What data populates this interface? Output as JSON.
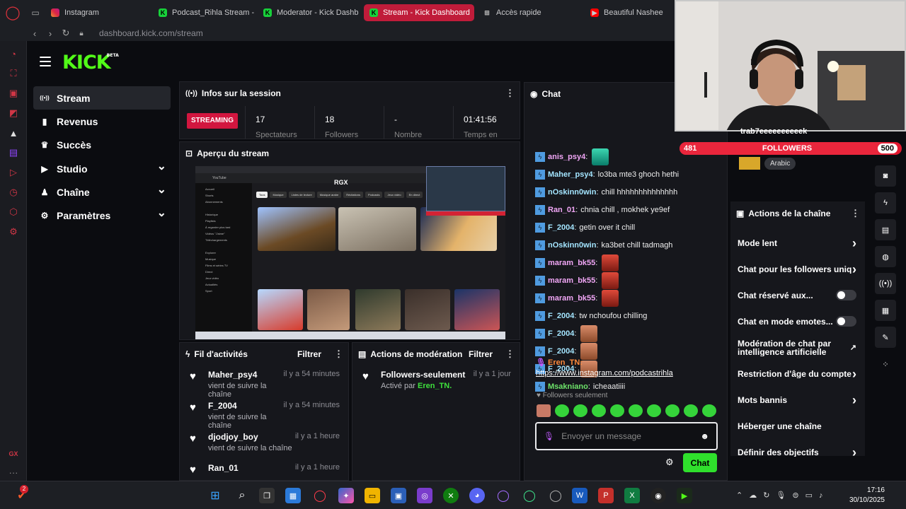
{
  "browser": {
    "tabs": [
      {
        "label": "Instagram",
        "fav": "insta"
      },
      {
        "label": "Podcast_Rihla Stream -",
        "fav": "kick"
      },
      {
        "label": "Moderator - Kick Dashb",
        "fav": "kick"
      },
      {
        "label": "Stream - Kick Dashboard",
        "fav": "kick",
        "active": true
      },
      {
        "label": "Accès rapide",
        "fav": "grid"
      },
      {
        "label": "Beautiful Nashee",
        "fav": "yt"
      }
    ],
    "url_host": "dashboard.kick.com",
    "url_path": "/stream"
  },
  "logo": {
    "text": "KICK",
    "beta": "BETA"
  },
  "left_nav": [
    {
      "label": "Stream",
      "icon": "broadcast-icon",
      "active": true
    },
    {
      "label": "Revenus",
      "icon": "chart-icon"
    },
    {
      "label": "Succès",
      "icon": "trophy-icon"
    },
    {
      "label": "Studio",
      "icon": "studio-icon",
      "expandable": true
    },
    {
      "label": "Chaîne",
      "icon": "person-icon",
      "expandable": true
    },
    {
      "label": "Paramètres",
      "icon": "gear-icon",
      "expandable": true
    }
  ],
  "session": {
    "title": "Infos sur la session",
    "status": "STREAMING",
    "stats": [
      {
        "value": "17",
        "label": "Spectateurs"
      },
      {
        "value": "18",
        "label": "Followers"
      },
      {
        "value": "-",
        "label": "Nombre"
      },
      {
        "value": "01:41:56",
        "label": "Temps en"
      }
    ]
  },
  "preview": {
    "title": "Aperçu du stream",
    "overlay_text": "RGX"
  },
  "activity": {
    "title": "Fil d'activités",
    "filter": "Filtrer",
    "items": [
      {
        "name": "Maher_psy4",
        "action": "vient de suivre la chaîne",
        "time": "il y a 54 minutes"
      },
      {
        "name": "F_2004",
        "action": "vient de suivre la chaîne",
        "time": "il y a 54 minutes"
      },
      {
        "name": "djodjoy_boy",
        "action": "vient de suivre la chaîne",
        "time": "il y a 1 heure"
      },
      {
        "name": "Ran_01",
        "action": "",
        "time": "il y a 1 heure"
      }
    ]
  },
  "moderation": {
    "title": "Actions de modération",
    "filter": "Filtrer",
    "items": [
      {
        "name": "Followers-seulement",
        "prefix": "Activé par",
        "by": "Eren_TN.",
        "time": "il y a 1 jour"
      }
    ]
  },
  "chat": {
    "title": "Chat",
    "messages": [
      {
        "user": "anis_psy4",
        "color": "#f0a6f5",
        "text": "",
        "emotes": 1
      },
      {
        "user": "Maher_psy4",
        "color": "#a4e5ff",
        "text": "lo3ba mte3 ghoch hethi"
      },
      {
        "user": "nOskinn0win",
        "color": "#a4e5ff",
        "text": "chill hhhhhhhhhhhhhh"
      },
      {
        "user": "Ran_01",
        "color": "#f0a6f5",
        "text": "chnia chill , mokhek ye9ef"
      },
      {
        "user": "F_2004",
        "color": "#a4e5ff",
        "text": "getin over it chill"
      },
      {
        "user": "nOskinn0win",
        "color": "#a4e5ff",
        "text": "ka3bet chill tadmagh"
      },
      {
        "user": "maram_bk55",
        "color": "#f0a6f5",
        "text": "",
        "emotes": 1
      },
      {
        "user": "maram_bk55",
        "color": "#f0a6f5",
        "text": "",
        "emotes": 1
      },
      {
        "user": "maram_bk55",
        "color": "#f0a6f5",
        "text": "",
        "emotes": 1
      },
      {
        "user": "F_2004",
        "color": "#a4e5ff",
        "text": "tw nchoufou chilling"
      },
      {
        "user": "F_2004",
        "color": "#a4e5ff",
        "text": "",
        "emotes": 1
      },
      {
        "user": "F_2004",
        "color": "#a4e5ff",
        "text": "",
        "emotes": 1
      },
      {
        "user": "F_2004",
        "color": "#a4e5ff",
        "text": "",
        "emotes": 1
      },
      {
        "user": "Msakniano",
        "color": "#6ee36a",
        "text": "icheaatiiii"
      }
    ],
    "pinned_user": "Eren_TN",
    "pinned_link": "https://www.instagram.com/podcastrihla",
    "mode_label": "Followers seulement",
    "input_placeholder": "Envoyer un message",
    "send_label": "Chat"
  },
  "overlay": {
    "ticker": "trab7eeeeeeeeeek",
    "followers_label": "FOLLOWERS",
    "followers_current": "481",
    "followers_goal": "500",
    "followers_progress": 0.962,
    "language": "Arabic"
  },
  "channel_actions": {
    "title": "Actions de la chaîne",
    "items": [
      {
        "label": "Mode lent",
        "control": "arrow"
      },
      {
        "label": "Chat pour les followers uniq",
        "control": "arrow"
      },
      {
        "label": "Chat réservé aux...",
        "control": "toggle"
      },
      {
        "label": "Chat en mode emotes...",
        "control": "toggle"
      },
      {
        "label": "Modération de chat par intelligence artificielle",
        "control": "external"
      },
      {
        "label": "Restriction d'âge du compte",
        "control": "arrow"
      },
      {
        "label": "Mots bannis",
        "control": "arrow"
      },
      {
        "label": "Héberger une chaîne",
        "control": "none"
      },
      {
        "label": "Définir des objectifs",
        "control": "arrow"
      }
    ]
  },
  "taskbar": {
    "time": "17:16",
    "date": "30/10/2025",
    "notif_badge": "2"
  }
}
